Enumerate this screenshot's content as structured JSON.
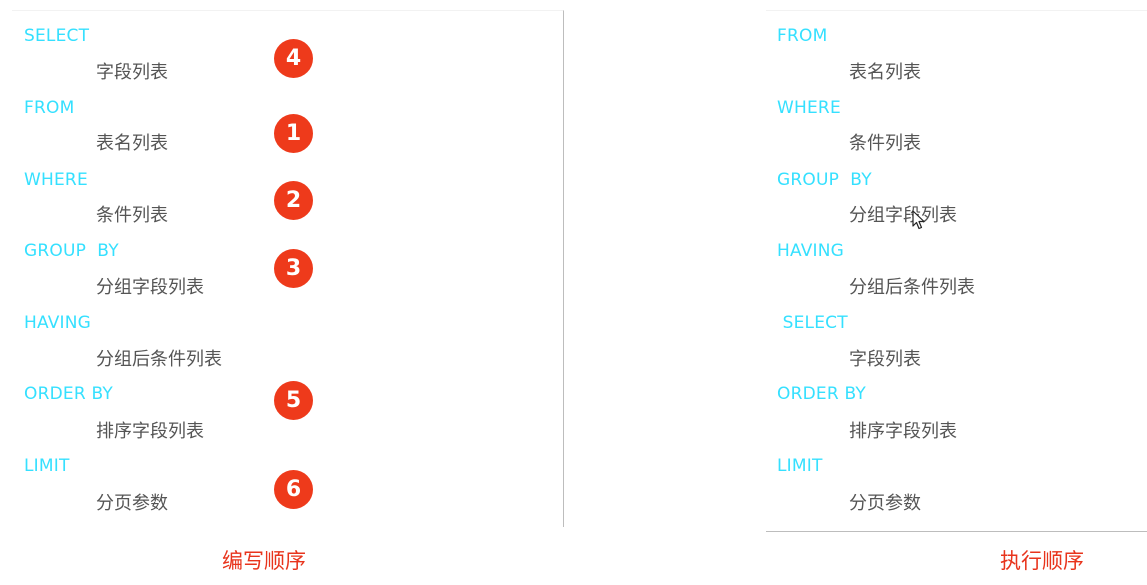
{
  "left": {
    "caption": "编写顺序",
    "rows": [
      {
        "keyword": "SELECT",
        "item": "字段列表",
        "badge": "4"
      },
      {
        "keyword": "FROM",
        "item": "表名列表",
        "badge": "1"
      },
      {
        "keyword": "WHERE",
        "item": "条件列表",
        "badge": "2"
      },
      {
        "keyword": "GROUP  BY",
        "item": "分组字段列表",
        "badge": "3"
      },
      {
        "keyword": "HAVING",
        "item": "分组后条件列表",
        "badge": ""
      },
      {
        "keyword": "ORDER BY",
        "item": "排序字段列表",
        "badge": "5"
      },
      {
        "keyword": "LIMIT",
        "item": "分页参数",
        "badge": "6"
      }
    ]
  },
  "right": {
    "caption": "执行顺序",
    "rows": [
      {
        "keyword": "FROM",
        "item": "表名列表"
      },
      {
        "keyword": "WHERE",
        "item": "条件列表"
      },
      {
        "keyword": "GROUP  BY",
        "item": "分组字段列表"
      },
      {
        "keyword": "HAVING",
        "item": "分组后条件列表"
      },
      {
        "keyword": " SELECT",
        "item": "字段列表"
      },
      {
        "keyword": "ORDER BY",
        "item": "排序字段列表"
      },
      {
        "keyword": "LIMIT",
        "item": "分页参数"
      }
    ]
  },
  "colors": {
    "keyword": "#35e0ff",
    "badge": "#ee3a1b",
    "caption": "#e8341c",
    "text": "#555555"
  }
}
